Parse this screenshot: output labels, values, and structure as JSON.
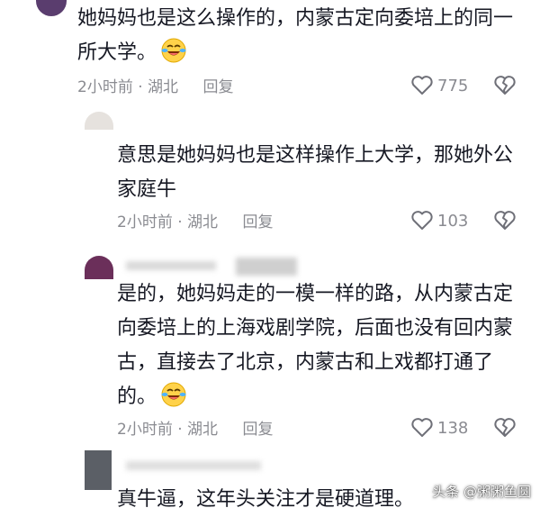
{
  "colors": {
    "text": "#161823",
    "meta": "#8a8b91",
    "icon": "#6f7078"
  },
  "emoji_name": "laughing-tears-emoji",
  "comments": [
    {
      "text": "她妈妈也是这么操作的，内蒙古定向委培上的同一\n所大学。",
      "time": "2小时前",
      "location": "· 湖北",
      "reply": "回复",
      "likes": "775"
    },
    {
      "text": "意思是她妈妈也是这样操作上大学，那她外公\n家庭牛",
      "time": "2小时前",
      "location": "· 湖北",
      "reply": "回复",
      "likes": "103"
    },
    {
      "text": "是的，她妈妈走的一模一样的路，从内蒙古定\n向委培上的上海戏剧学院，后面也没有回内蒙\n古，直接去了北京，内蒙古和上戏都打通了\n的。",
      "time": "2小时前",
      "location": "· 湖北",
      "reply": "回复",
      "likes": "138"
    },
    {
      "text": "真牛逼，这年头关注才是硬道理。"
    }
  ],
  "watermark": "头条 @粥粥鱼圆"
}
